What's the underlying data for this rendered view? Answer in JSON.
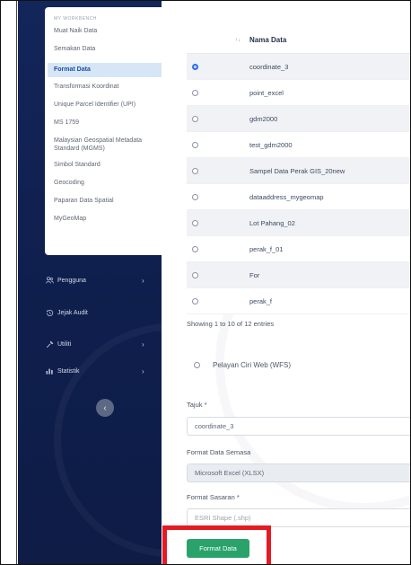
{
  "sidebar": {
    "submenu_heading": "MY WORKBENCH",
    "submenu_items": [
      {
        "label": "Muat Naik Data",
        "active": false
      },
      {
        "label": "Semakan Data",
        "active": false
      },
      {
        "label": "Format Data",
        "active": true
      },
      {
        "label": "Transformasi Koordinat",
        "active": false
      },
      {
        "label": "Unique Parcel Identifier (UPI)",
        "active": false
      },
      {
        "label": "MS 1759",
        "active": false
      },
      {
        "label": "Malaysian Geospatial Metadata Standard (MGMS)",
        "active": false
      },
      {
        "label": "Simbol Standard",
        "active": false
      },
      {
        "label": "Geocoding",
        "active": false
      },
      {
        "label": "Paparan Data Spatial",
        "active": false
      },
      {
        "label": "MyGeoMap",
        "active": false
      }
    ],
    "nav": [
      {
        "label": "Pengguna",
        "icon": "users-icon",
        "has_chevron": true
      },
      {
        "label": "Jejak Audit",
        "icon": "history-icon",
        "has_chevron": false
      },
      {
        "label": "Utiliti",
        "icon": "wrench-icon",
        "has_chevron": true
      },
      {
        "label": "Statistik",
        "icon": "bar-chart-icon",
        "has_chevron": true
      }
    ],
    "collapse_icon": "chevron-left-icon",
    "colors": {
      "background": "#13265a",
      "active_bg": "#d7e6f7",
      "active_text": "#1a4f9e"
    }
  },
  "table": {
    "header": {
      "sort_icon": "sort-arrows-icon",
      "sort_glyph": "↑↓",
      "name": "Nama Data"
    },
    "rows": [
      {
        "name": "coordinate_3",
        "selected": true
      },
      {
        "name": "point_excel",
        "selected": false
      },
      {
        "name": "gdm2000",
        "selected": false
      },
      {
        "name": "test_gdm2000",
        "selected": false
      },
      {
        "name": "Sampel Data Perak GIS_20new",
        "selected": false
      },
      {
        "name": "dataaddress_mygeomap",
        "selected": false
      },
      {
        "name": "Lot Pahang_02",
        "selected": false
      },
      {
        "name": "perak_f_01",
        "selected": false
      },
      {
        "name": "For",
        "selected": false
      },
      {
        "name": "perak_f",
        "selected": false
      }
    ],
    "entries_info": "Showing 1 to 10 of 12 entries"
  },
  "form": {
    "wfs_option": "Pelayan Ciri Web (WFS)",
    "tajuk_label": "Tajuk *",
    "tajuk_value": "coordinate_3",
    "current_format_label": "Format Data Semasa",
    "current_format_value": "Microsoft Excel (XLSX)",
    "target_format_label": "Format Sasaran *",
    "target_format_value": "ESRI Shape (.shp)",
    "submit_label": "Format Data",
    "colors": {
      "submit": "#2aa36a",
      "highlight": "#e31b23",
      "radio_selected": "#2b6ff2"
    }
  }
}
